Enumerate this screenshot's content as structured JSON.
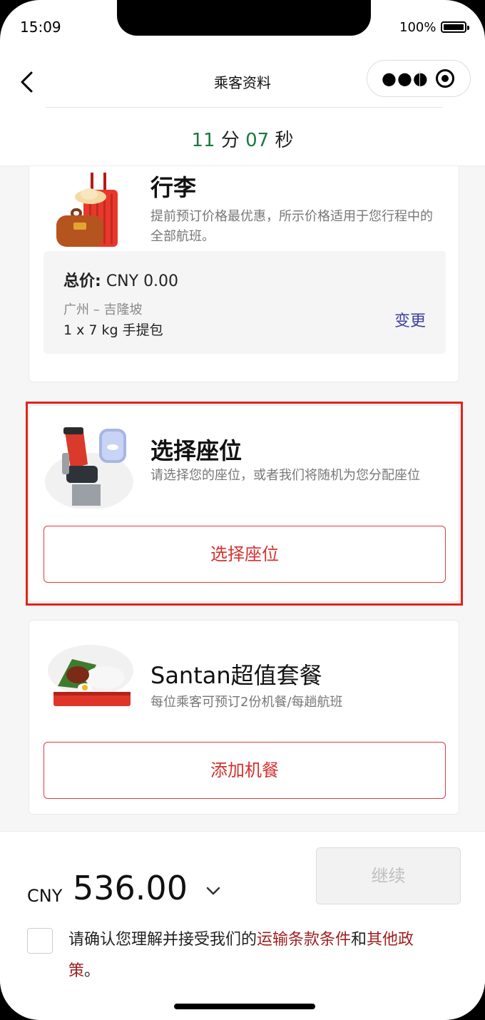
{
  "status_bar": {
    "time": "15:09",
    "battery": "100%"
  },
  "nav": {
    "title": "乘客资料"
  },
  "timer": {
    "minutes": "11",
    "minutes_unit": "分",
    "seconds": "07",
    "seconds_unit": "秒"
  },
  "baggage": {
    "title": "行李",
    "description": "提前预订价格最优惠，所示价格适用于您行程中的全部航班。",
    "total_label": "总价:",
    "total_value": "CNY 0.00",
    "route": "广州 – 吉隆坡",
    "item": "1 x 7 kg 手提包",
    "change_label": "变更"
  },
  "seat": {
    "title": "选择座位",
    "description": "请选择您的座位，或者我们将随机为您分配座位",
    "button_label": "选择座位"
  },
  "meal": {
    "title": "Santan超值套餐",
    "description": "每位乘客可预订2份机餐/每趟航班",
    "button_label": "添加机餐"
  },
  "footer": {
    "currency": "CNY",
    "total": "536.00",
    "continue_label": "继续",
    "terms_prefix": "请确认您理解并接受我们的",
    "terms_link1": "运输条款条件",
    "terms_and": "和",
    "terms_link2": "其他政策",
    "terms_suffix": "。"
  },
  "colors": {
    "accent_red": "#d5312f",
    "timer_green": "#1b7a3e",
    "link_purple": "#3e3f9f",
    "link_darkred": "#9d1f1f"
  }
}
